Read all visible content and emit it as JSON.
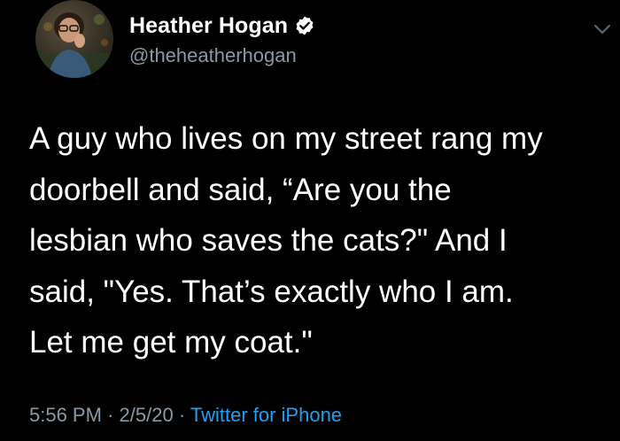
{
  "author": {
    "display_name": "Heather Hogan",
    "handle": "@theheatherhogan",
    "verified": true
  },
  "icons": {
    "verified": "verified-badge-icon",
    "menu": "chevron-down-icon"
  },
  "tweet": {
    "lines": [
      "A guy who lives on my street rang my",
      "doorbell and said, “Are you the",
      "lesbian who saves the cats?\" And I",
      "said, \"Yes. That’s exactly who I am.",
      "Let me get my coat.\""
    ]
  },
  "meta": {
    "time": "5:56 PM",
    "separator": "·",
    "date": "2/5/20",
    "source": "Twitter for iPhone"
  },
  "colors": {
    "background": "#000000",
    "text": "#ffffff",
    "secondary": "#8899a6",
    "link": "#1da1f2"
  }
}
